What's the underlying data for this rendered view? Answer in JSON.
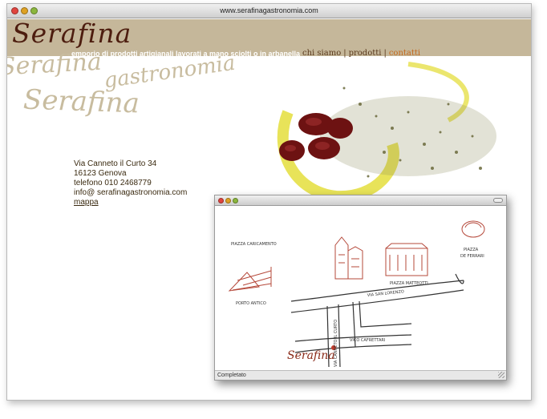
{
  "browser": {
    "url": "www.serafinagastronomia.com"
  },
  "site": {
    "logo": "Serafina",
    "tagline": "emporio di prodotti artigianali lavorati a mano sciolti o in arbanella",
    "nav": [
      {
        "label": "chi siamo"
      },
      {
        "label": "prodotti"
      },
      {
        "label": "contatti",
        "active": true
      }
    ],
    "address": {
      "street": "Via Canneto il Curto 34",
      "city": "16123 Genova",
      "phone": "telefono 010 2468779",
      "email": "info@ serafinagastronomia.com",
      "map_link": "mappa"
    },
    "background_script": [
      "Serafina",
      "gastronomia",
      "Serafina"
    ]
  },
  "popup": {
    "status": "Completato",
    "map": {
      "piazza_caricamento": "PIAZZA CARICAMENTO",
      "porto_antico": "PORTO ANTICO",
      "piazza_matteotti": "PIAZZA MATTEOTTI",
      "piazza_ferrari_1": "PIAZZA",
      "piazza_ferrari_2": "DE FERRARI",
      "via_san_lorenzo": "VIA SAN LORENZO",
      "vico_cafrettari": "VICO CAFRETTARI",
      "via_canneto": "VIA CANNETO IL CURTO",
      "logo": "Serafina"
    }
  },
  "colors": {
    "header_bg": "#c5b79a",
    "logo": "#4d1d0f",
    "nav_active": "#c46a1e",
    "map_red": "#b5483a"
  }
}
